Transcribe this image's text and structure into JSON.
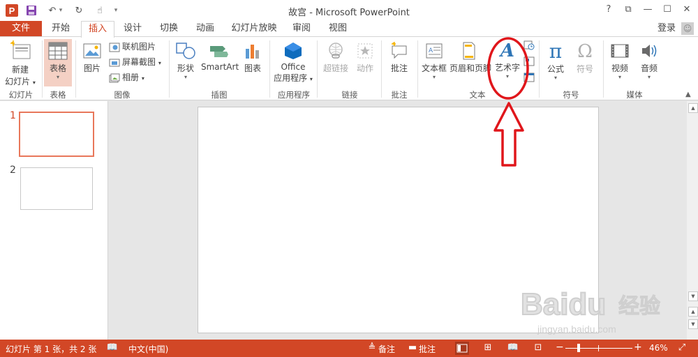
{
  "window": {
    "title": "故宫 - Microsoft PowerPoint",
    "help": "?",
    "restore_ribbon": "⧉",
    "minimize": "—",
    "maximize": "☐",
    "close": "✕"
  },
  "qat": {
    "app_letter": "P",
    "save": "💾",
    "undo": "↶",
    "undo_dd": "▾",
    "redo": "↻",
    "touch": "☝",
    "customize": "▾"
  },
  "tabs": [
    "开始",
    "插入",
    "设计",
    "切换",
    "动画",
    "幻灯片放映",
    "审阅",
    "视图"
  ],
  "active_tab": "插入",
  "file_tab": "文件",
  "account": {
    "signin": "登录"
  },
  "ribbon": {
    "slides": {
      "new_slide": "新建",
      "new_slide2": "幻灯片",
      "group": "幻灯片"
    },
    "tables": {
      "table": "表格",
      "group": "表格"
    },
    "images": {
      "picture": "图片",
      "online_pictures": "联机图片",
      "screenshot": "屏幕截图",
      "album": "相册",
      "group": "图像"
    },
    "illustrations": {
      "shapes": "形状",
      "smartart": "SmartArt",
      "chart": "图表",
      "group": "插图"
    },
    "apps": {
      "office": "Office",
      "office2": "应用程序",
      "group": "应用程序"
    },
    "links": {
      "hyperlink": "超链接",
      "action": "动作",
      "group": "链接"
    },
    "comments": {
      "comment": "批注",
      "group": "批注"
    },
    "text": {
      "textbox": "文本框",
      "header_footer": "页眉和页脚",
      "wordart": "艺术字",
      "wordart_glyph": "A",
      "group": "文本"
    },
    "symbols": {
      "equation": "公式",
      "pi": "π",
      "symbol": "符号",
      "omega": "Ω",
      "group": "符号"
    },
    "media": {
      "video": "视频",
      "audio": "音频",
      "group": "媒体"
    }
  },
  "slides": [
    {
      "number": "1"
    },
    {
      "number": "2"
    }
  ],
  "statusbar": {
    "slide_info": "幻灯片 第 1 张，共 2 张",
    "language": "中文(中国)",
    "notes": "备注",
    "comments": "批注",
    "zoom_minus": "−",
    "zoom_plus": "+",
    "zoom_level": "46%",
    "zoom_fraction": 0.46
  },
  "colors": {
    "accent": "#d24726",
    "annotation": "#e0161b"
  },
  "watermark": {
    "brand": "Baidu",
    "cn": "经验",
    "url": "jingyan.baidu.com"
  }
}
